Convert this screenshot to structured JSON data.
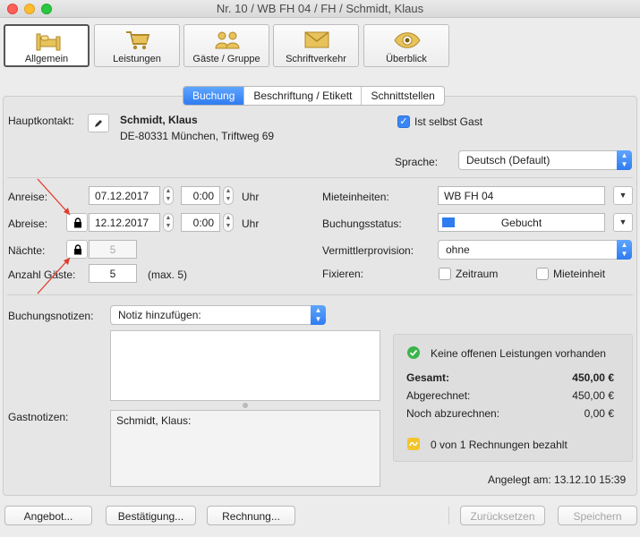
{
  "window": {
    "title": "Nr. 10 / WB FH 04 / FH / Schmidt, Klaus"
  },
  "toolbar": {
    "items": [
      {
        "label": "Allgemein",
        "icon": "bed-icon"
      },
      {
        "label": "Leistungen",
        "icon": "cart-icon"
      },
      {
        "label": "Gäste / Gruppe",
        "icon": "people-icon"
      },
      {
        "label": "Schriftverkehr",
        "icon": "envelope-icon"
      },
      {
        "label": "Überblick",
        "icon": "eye-icon"
      }
    ]
  },
  "tabs": [
    "Buchung",
    "Beschriftung / Etikett",
    "Schnittstellen"
  ],
  "contact": {
    "label": "Hauptkontakt:",
    "name": "Schmidt, Klaus",
    "address": "DE-80331 München, Triftweg 69",
    "self_guest_label": "Ist selbst Gast",
    "self_guest_checked": true
  },
  "language": {
    "label": "Sprache:",
    "value": "Deutsch (Default)"
  },
  "dates": {
    "arrival_label": "Anreise:",
    "arrival_date": "07.12.2017",
    "arrival_time": "0:00",
    "departure_label": "Abreise:",
    "departure_date": "12.12.2017",
    "departure_time": "0:00",
    "time_unit": "Uhr",
    "nights_label": "Nächte:",
    "nights": "5",
    "guests_label": "Anzahl Gäste:",
    "guests": "5",
    "guests_max": "(max. 5)"
  },
  "booking": {
    "units_label": "Mieteinheiten:",
    "units_value": "WB FH 04",
    "status_label": "Buchungsstatus:",
    "status_value": "Gebucht",
    "status_color": "#2f7cf0",
    "agent_label": "Vermittlerprovision:",
    "agent_value": "ohne",
    "fix_label": "Fixieren:",
    "fix_period": "Zeitraum",
    "fix_unit": "Mieteinheit"
  },
  "notes": {
    "booking_label": "Buchungsnotizen:",
    "add_note": "Notiz hinzufügen:",
    "booking_text": "",
    "guest_label": "Gastnotizen:",
    "guest_text": "Schmidt, Klaus:"
  },
  "summary": {
    "status_text": "Keine offenen Leistungen vorhanden",
    "total_label": "Gesamt:",
    "total_value": "450,00 €",
    "billed_label": "Abgerechnet:",
    "billed_value": "450,00 €",
    "open_label": "Noch abzurechnen:",
    "open_value": "0,00 €",
    "invoices_text": "0 von 1 Rechnungen bezahlt"
  },
  "created": "Angelegt am: 13.12.10 15:39",
  "buttons": {
    "offer": "Angebot...",
    "confirmation": "Bestätigung...",
    "invoice": "Rechnung...",
    "reset": "Zurücksetzen",
    "save": "Speichern"
  },
  "colors": {
    "accent": "#2f7cf0",
    "ok_green": "#3cb44b",
    "warn_yellow": "#f3c52c",
    "arrow_red": "#e03a2a"
  }
}
